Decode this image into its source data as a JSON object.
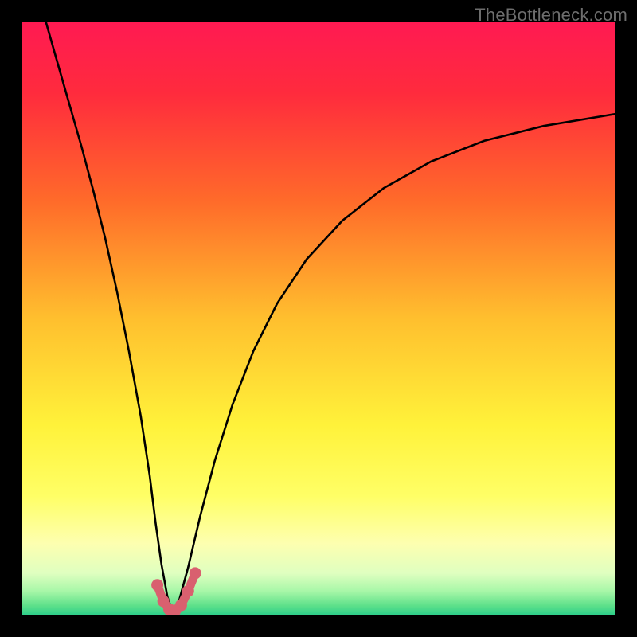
{
  "watermark": "TheBottleneck.com",
  "chart_data": {
    "type": "line",
    "title": "",
    "xlabel": "",
    "ylabel": "",
    "xlim": [
      0,
      1
    ],
    "ylim": [
      0,
      1
    ],
    "notch": {
      "x": 0.255,
      "y_min": 0.0
    },
    "gradient_stops": [
      {
        "offset": 0.0,
        "color": "#ff1a52"
      },
      {
        "offset": 0.12,
        "color": "#ff2b3d"
      },
      {
        "offset": 0.3,
        "color": "#ff6a2a"
      },
      {
        "offset": 0.5,
        "color": "#ffbf2e"
      },
      {
        "offset": 0.68,
        "color": "#fff23a"
      },
      {
        "offset": 0.8,
        "color": "#ffff66"
      },
      {
        "offset": 0.88,
        "color": "#fdffb0"
      },
      {
        "offset": 0.93,
        "color": "#dfffc0"
      },
      {
        "offset": 0.96,
        "color": "#a8f7a8"
      },
      {
        "offset": 0.985,
        "color": "#5de08a"
      },
      {
        "offset": 1.0,
        "color": "#2fcf8a"
      }
    ],
    "curve_left": [
      {
        "x": 0.04,
        "y": 1.0
      },
      {
        "x": 0.06,
        "y": 0.93
      },
      {
        "x": 0.08,
        "y": 0.86
      },
      {
        "x": 0.1,
        "y": 0.79
      },
      {
        "x": 0.12,
        "y": 0.715
      },
      {
        "x": 0.14,
        "y": 0.635
      },
      {
        "x": 0.16,
        "y": 0.545
      },
      {
        "x": 0.18,
        "y": 0.445
      },
      {
        "x": 0.2,
        "y": 0.335
      },
      {
        "x": 0.215,
        "y": 0.235
      },
      {
        "x": 0.225,
        "y": 0.155
      },
      {
        "x": 0.235,
        "y": 0.085
      },
      {
        "x": 0.245,
        "y": 0.03
      },
      {
        "x": 0.255,
        "y": 0.0
      }
    ],
    "curve_right": [
      {
        "x": 0.255,
        "y": 0.0
      },
      {
        "x": 0.265,
        "y": 0.025
      },
      {
        "x": 0.28,
        "y": 0.08
      },
      {
        "x": 0.3,
        "y": 0.165
      },
      {
        "x": 0.325,
        "y": 0.26
      },
      {
        "x": 0.355,
        "y": 0.355
      },
      {
        "x": 0.39,
        "y": 0.445
      },
      {
        "x": 0.43,
        "y": 0.525
      },
      {
        "x": 0.48,
        "y": 0.6
      },
      {
        "x": 0.54,
        "y": 0.665
      },
      {
        "x": 0.61,
        "y": 0.72
      },
      {
        "x": 0.69,
        "y": 0.765
      },
      {
        "x": 0.78,
        "y": 0.8
      },
      {
        "x": 0.88,
        "y": 0.825
      },
      {
        "x": 1.0,
        "y": 0.845
      }
    ],
    "highlight_points": [
      {
        "x": 0.228,
        "y": 0.05
      },
      {
        "x": 0.238,
        "y": 0.023
      },
      {
        "x": 0.248,
        "y": 0.009
      },
      {
        "x": 0.258,
        "y": 0.007
      },
      {
        "x": 0.268,
        "y": 0.016
      },
      {
        "x": 0.28,
        "y": 0.04
      },
      {
        "x": 0.292,
        "y": 0.07
      }
    ],
    "highlight_color": "#d9606f"
  }
}
